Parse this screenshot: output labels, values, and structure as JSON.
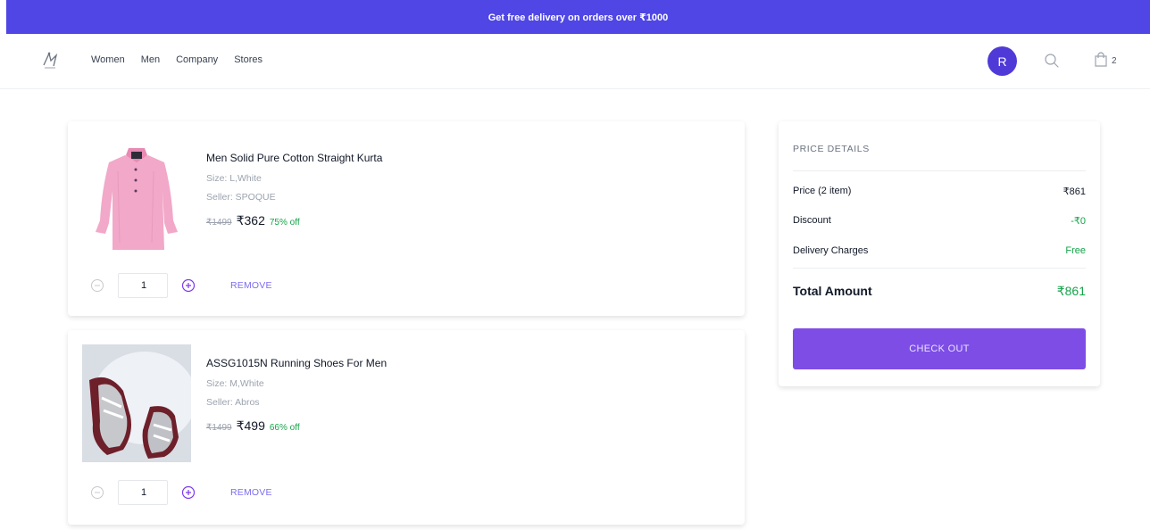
{
  "banner": {
    "text": "Get free delivery on orders over ₹1000"
  },
  "nav": {
    "links": [
      "Women",
      "Men",
      "Company",
      "Stores"
    ],
    "avatar_initial": "R",
    "cart_count": "2"
  },
  "cart": {
    "items": [
      {
        "title": "Men Solid Pure Cotton Straight Kurta",
        "size": "Size: L,White",
        "seller": "Seller: SPOQUE",
        "mrp": "₹1499",
        "price": "₹362",
        "discount": "75% off",
        "quantity": "1",
        "remove_label": "REMOVE"
      },
      {
        "title": "ASSG1015N Running Shoes For Men",
        "size": "Size: M,White",
        "seller": "Seller: Abros",
        "mrp": "₹1499",
        "price": "₹499",
        "discount": "66% off",
        "quantity": "1",
        "remove_label": "REMOVE"
      }
    ]
  },
  "price_details": {
    "heading": "PRICE DETAILS",
    "price_label": "Price (2 item)",
    "price_value": "₹861",
    "discount_label": "Discount",
    "discount_value": "-₹0",
    "delivery_label": "Delivery Charges",
    "delivery_value": "Free",
    "total_label": "Total Amount",
    "total_value": "₹861",
    "checkout_label": "CHECK OUT"
  },
  "colors": {
    "brand": "#4f46e5",
    "accent": "#7e4de6",
    "success": "#16a34a"
  }
}
